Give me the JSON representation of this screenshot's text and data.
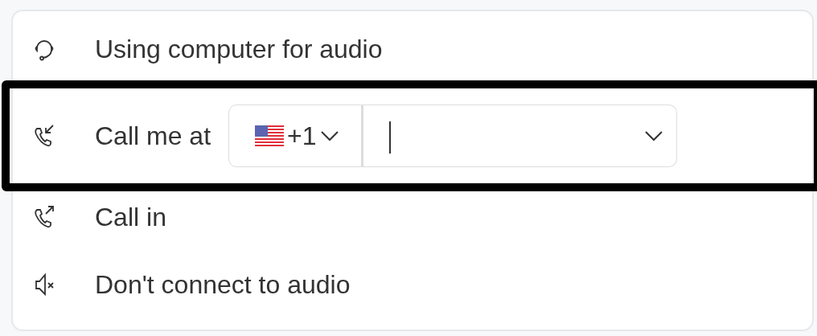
{
  "options": [
    {
      "kind": "computer",
      "label": "Using computer for audio",
      "highlighted": false
    },
    {
      "kind": "call-me",
      "label": "Call me at",
      "highlighted": true,
      "country_code": "+1"
    },
    {
      "kind": "call-in",
      "label": "Call in",
      "highlighted": false
    },
    {
      "kind": "none",
      "label": "Don't connect to audio",
      "highlighted": false
    }
  ]
}
